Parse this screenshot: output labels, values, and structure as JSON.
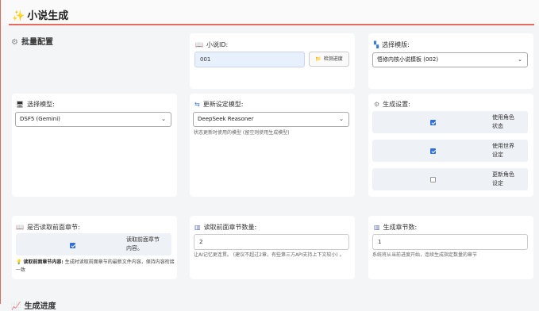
{
  "header": {
    "title": "小说生成",
    "icon": "sparkles-icon"
  },
  "section": {
    "title": "批量配置"
  },
  "novel_id": {
    "label": "小说ID:",
    "value": "001",
    "detect_button": "检测进度"
  },
  "template": {
    "label": "选择模版:",
    "selected": "悟修内核小说模板 (002)"
  },
  "model": {
    "label": "选择模型:",
    "selected": "DSF5 (Gemini)"
  },
  "update_model": {
    "label": "更新设定模型:",
    "selected": "DeepSeek Reasoner",
    "help": "状态更新时使用的模型 (留空则使用生成模型)"
  },
  "gen_settings": {
    "label": "生成设置:",
    "options": [
      {
        "label": "使用角色\n状态",
        "checked": true
      },
      {
        "label": "使用世界\n设定",
        "checked": true
      },
      {
        "label": "更新角色\n设定",
        "checked": false
      }
    ]
  },
  "read_previous": {
    "label": "是否读取前面章节:",
    "option_label": "读取前面章节\n内容。",
    "checked": true,
    "note_bold": "读取前面章节内容:",
    "note_text": " 生成时读取前面章节的最新文件内容，保持内容衔接一致"
  },
  "prev_count": {
    "label": "读取前面章节数量:",
    "value": "2",
    "help": "让AI记忆更连贯。 (建议不超过2章，有些第三方API支持上下文较小) 。"
  },
  "chapter_count": {
    "label": "生成章节数:",
    "value": "1",
    "help": "系统将从当前进度开始，连续生成指定数量的章节"
  },
  "footer": {
    "title": "生成进度"
  },
  "colors": {
    "accent": "#e46b5e",
    "checkbox": "#2f6fdf",
    "input_highlight": "#e8f0fe"
  }
}
